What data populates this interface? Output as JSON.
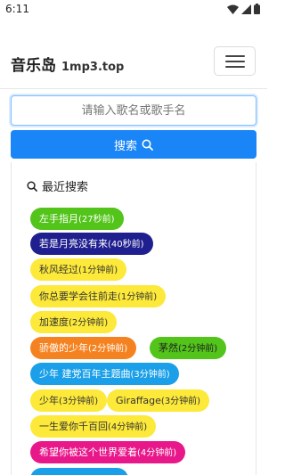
{
  "status": {
    "time": "6:11"
  },
  "header": {
    "brand": "音乐岛",
    "domain": "1mp3.top"
  },
  "search": {
    "placeholder": "请输入歌名或歌手名",
    "button_label": "搜索"
  },
  "recent": {
    "title": "最近搜索",
    "items": [
      {
        "name": "左手指月",
        "time": "(27秒前)",
        "bg": "#52c41a",
        "fg": "#ffffff"
      },
      {
        "name": "若是月亮没有来",
        "time": "(40秒前)",
        "bg": "#1f1f8f",
        "fg": "#ffffff"
      },
      {
        "name": "秋风经过",
        "time": "(1分钟前)",
        "bg": "#fce939",
        "fg": "#333333"
      },
      {
        "name": "你总要学会往前走",
        "time": "(1分钟前)",
        "bg": "#fce939",
        "fg": "#333333"
      },
      {
        "name": "加速度",
        "time": "(2分钟前)",
        "bg": "#fce939",
        "fg": "#333333"
      },
      {
        "name": "骄傲的少年",
        "time": "(2分钟前)",
        "bg": "#f58220",
        "fg": "#ffffff"
      },
      {
        "name": "茅然",
        "time": "(2分钟前)",
        "bg": "#52c41a",
        "fg": "#222222"
      },
      {
        "name": "少年 建党百年主题曲",
        "time": "(3分钟前)",
        "bg": "#1a9fe8",
        "fg": "#ffffff"
      },
      {
        "name": "少年",
        "time": "(3分钟前)",
        "bg": "#fce939",
        "fg": "#333333"
      },
      {
        "name": "Giraffage",
        "time": "(3分钟前)",
        "bg": "#fce939",
        "fg": "#333333"
      },
      {
        "name": "一生爱你千百回",
        "time": "(4分钟前)",
        "bg": "#fce939",
        "fg": "#333333"
      },
      {
        "name": "希望你被这个世界爱着",
        "time": "(4分钟前)",
        "bg": "#e8178a",
        "fg": "#ffffff"
      },
      {
        "name": "",
        "time": "",
        "bg": "#1a9fe8",
        "fg": "#ffffff"
      }
    ]
  }
}
